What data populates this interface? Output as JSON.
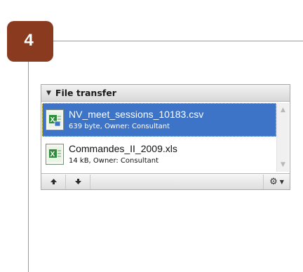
{
  "step": {
    "number": "4"
  },
  "pod": {
    "title": "File transfer",
    "files": [
      {
        "name": "NV_meet_sessions_10183.csv",
        "meta": "639 byte, Owner: Consultant",
        "icon": "excel-file-icon",
        "selected": true
      },
      {
        "name": "Commandes_II_2009.xls",
        "meta": "14 kB, Owner: Consultant",
        "icon": "excel-file-icon",
        "selected": false
      }
    ],
    "toolbar": {
      "move_up_icon": "arrow-up-icon",
      "move_down_icon": "arrow-down-icon",
      "options_icon": "gear-icon"
    }
  },
  "colors": {
    "badge": "#8a3a1f",
    "selection": "#3d74c8"
  }
}
